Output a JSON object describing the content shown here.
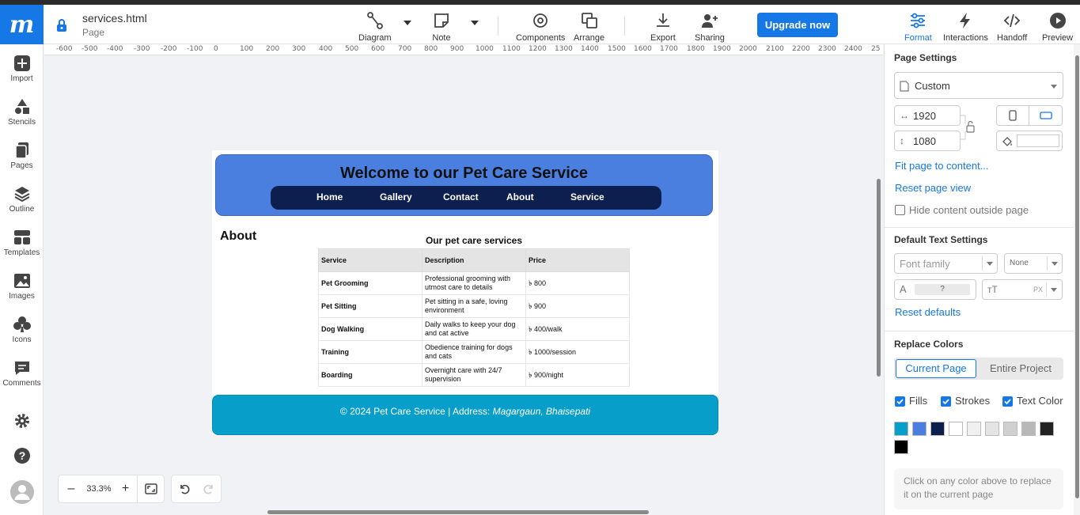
{
  "app": {
    "logo": "m"
  },
  "file": {
    "name": "services.html",
    "type": "Page"
  },
  "toolbar": {
    "diagram": "Diagram",
    "note": "Note",
    "components": "Components",
    "arrange": "Arrange",
    "export": "Export",
    "sharing": "Sharing",
    "upgrade": "Upgrade now",
    "format": "Format",
    "interactions": "Interactions",
    "handoff": "Handoff",
    "preview": "Preview"
  },
  "sidebar": {
    "import": "Import",
    "stencils": "Stencils",
    "pages": "Pages",
    "outline": "Outline",
    "templates": "Templates",
    "images": "Images",
    "icons": "Icons",
    "comments": "Comments"
  },
  "ruler": [
    "-600",
    "-500",
    "-400",
    "-300",
    "-200",
    "-100",
    "0",
    "100",
    "200",
    "300",
    "400",
    "500",
    "600",
    "700",
    "800",
    "900",
    "1000",
    "1100",
    "1200",
    "1300",
    "1400",
    "1500",
    "1600",
    "1700",
    "1800",
    "1900",
    "2000",
    "2100",
    "2200",
    "2300",
    "2400",
    "25"
  ],
  "site": {
    "title": "Welcome to our Pet Care Service",
    "nav": [
      "Home",
      "Gallery",
      "Contact",
      "About",
      "Service"
    ],
    "about_heading": "About",
    "table_caption": "Our pet care services",
    "columns": [
      "Service",
      "Description",
      "Price"
    ],
    "rows": [
      [
        "Pet Grooming",
        "Professional grooming with utmost care to details",
        "৳ 800"
      ],
      [
        "Pet Sitting",
        "Pet sitting in a safe, loving environment",
        "৳ 900"
      ],
      [
        "Dog Walking",
        "Daily walks to keep your dog and cat active",
        "৳ 400/walk"
      ],
      [
        "Training",
        "Obedience training for dogs and cats",
        "৳ 1000/session"
      ],
      [
        "Boarding",
        "Overnight care with 24/7 supervision",
        "৳ 900/night"
      ]
    ],
    "footer_text": "© 2024 Pet Care Service | Address: ",
    "footer_address": "Magargaun, Bhaisepati"
  },
  "zoom": {
    "level": "33.3%"
  },
  "panel": {
    "page_settings": "Page Settings",
    "preset": "Custom",
    "width": "1920",
    "height": "1080",
    "fit": "Fit page to content...",
    "reset_view": "Reset page view",
    "hide_outside": "Hide content outside page",
    "default_text": "Default Text Settings",
    "font_family": "Font family",
    "font_weight": "None",
    "size_placeholder": "?",
    "unit": "PX",
    "reset_defaults": "Reset defaults",
    "replace_colors": "Replace Colors",
    "tab_current": "Current Page",
    "tab_project": "Entire Project",
    "fills": "Fills",
    "strokes": "Strokes",
    "text_color": "Text Color",
    "colors": [
      "#079ec9",
      "#4a7fe0",
      "#0c1f4e",
      "#ffffff",
      "#f0f0f0",
      "#e4e4e4",
      "#d0d0d0",
      "#b8b8b8",
      "#222222",
      "#000000"
    ],
    "hint": "Click on any color above to replace it on the current page"
  }
}
